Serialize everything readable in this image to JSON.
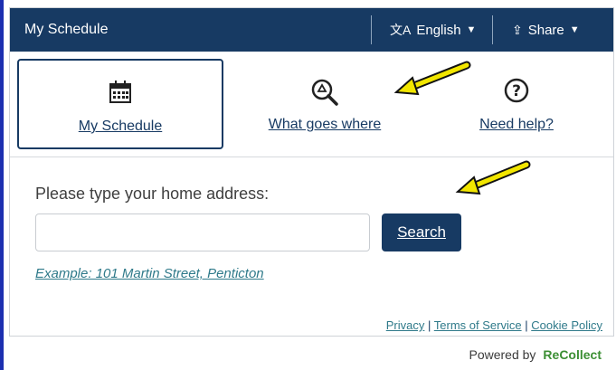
{
  "header": {
    "title": "My Schedule",
    "language_label": "English",
    "share_label": "Share"
  },
  "nav": {
    "items": [
      {
        "label": "My Schedule",
        "icon": "calendar-icon",
        "active": true
      },
      {
        "label": "What goes where",
        "icon": "recycle-search-icon",
        "active": false
      },
      {
        "label": "Need help?",
        "icon": "help-circle-icon",
        "active": false
      }
    ]
  },
  "search": {
    "prompt": "Please type your home address:",
    "input_value": "",
    "button_label": "Search",
    "example": "Example: 101 Martin Street, Penticton"
  },
  "footer": {
    "privacy": "Privacy",
    "sep1": "|",
    "terms": "Terms of Service",
    "sep2": "|",
    "cookie": "Cookie Policy",
    "powered_by": "Powered by",
    "brand": "ReCollect"
  },
  "colors": {
    "header_bg": "#173a63",
    "accent": "#173a63",
    "link": "#2f7a8a",
    "annotation_arrow": "#f2e600"
  }
}
